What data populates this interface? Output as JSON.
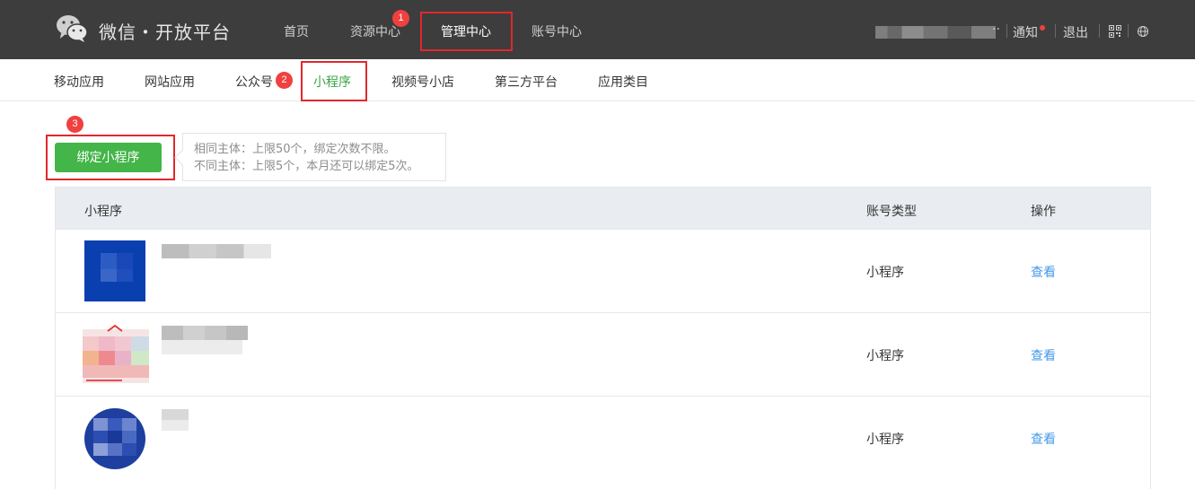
{
  "brand": {
    "title": "微信・开放平台"
  },
  "topnav": {
    "items": [
      {
        "label": "首页"
      },
      {
        "label": "资源中心"
      },
      {
        "label": "管理中心"
      },
      {
        "label": "账号中心"
      }
    ]
  },
  "header_right": {
    "notify_label": "通知",
    "logout_label": "退出"
  },
  "subnav": {
    "items": [
      {
        "label": "移动应用"
      },
      {
        "label": "网站应用"
      },
      {
        "label": "公众号"
      },
      {
        "label": "小程序"
      },
      {
        "label": "视频号小店"
      },
      {
        "label": "第三方平台"
      },
      {
        "label": "应用类目"
      }
    ]
  },
  "annotations": {
    "step1": "1",
    "step2": "2",
    "step3": "3"
  },
  "actions": {
    "bind_label": "绑定小程序"
  },
  "tip": {
    "line1": "相同主体：上限50个，绑定次数不限。",
    "line2": "不同主体：上限5个，本月还可以绑定5次。"
  },
  "table": {
    "headers": {
      "name": "小程序",
      "type": "账号类型",
      "action": "操作"
    },
    "rows": [
      {
        "type": "小程序",
        "action": "查看"
      },
      {
        "type": "小程序",
        "action": "查看"
      },
      {
        "type": "小程序",
        "action": "查看"
      }
    ]
  },
  "colors": {
    "accent": "#44b549",
    "highlight_border": "#e0282e",
    "link": "#459ae9",
    "topbar": "#3d3d3d"
  }
}
